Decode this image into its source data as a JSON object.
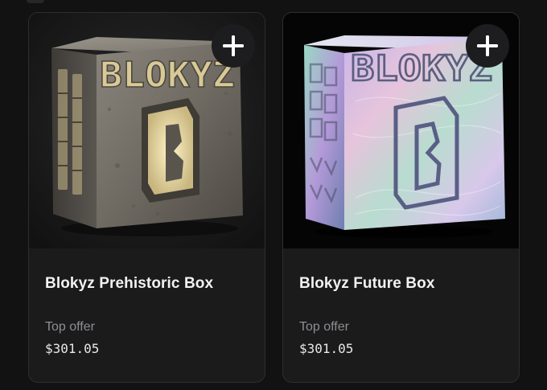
{
  "cards": [
    {
      "title": "Blokyz Prehistoric Box",
      "offer_label": "Top offer",
      "price": "$301.05",
      "image_icon": "stone-cube-image",
      "cube_text": "BLOKYZ",
      "action_icon": "plus-icon"
    },
    {
      "title": "Blokyz Future Box",
      "offer_label": "Top offer",
      "price": "$301.05",
      "image_icon": "holographic-cube-image",
      "cube_text": "BLOKYZ",
      "action_icon": "plus-icon"
    }
  ],
  "colors": {
    "page_bg": "#121212",
    "card_bg": "#1b1b1c",
    "title": "#f2f2f2",
    "muted": "#8e8e93"
  }
}
